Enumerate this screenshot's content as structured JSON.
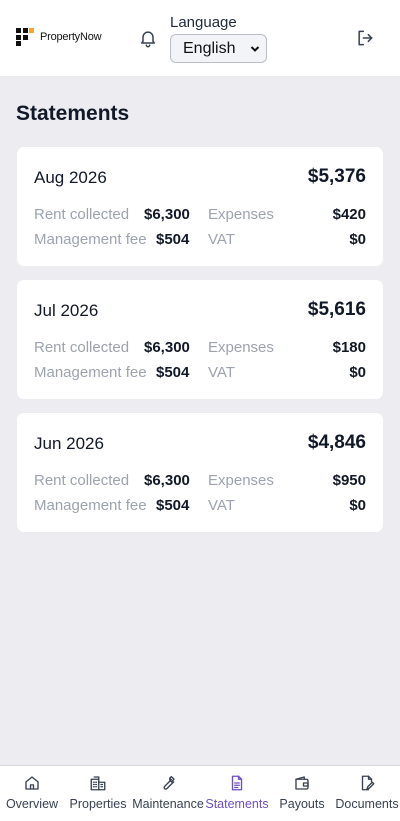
{
  "header": {
    "brand": "PropertyNow",
    "language_label": "Language",
    "language_value": "English"
  },
  "page": {
    "title": "Statements"
  },
  "statements": [
    {
      "month": "Aug 2026",
      "total": "$5,376",
      "rent_label": "Rent collected",
      "rent": "$6,300",
      "expenses_label": "Expenses",
      "expenses": "$420",
      "fee_label": "Management fee",
      "fee": "$504",
      "vat_label": "VAT",
      "vat": "$0"
    },
    {
      "month": "Jul 2026",
      "total": "$5,616",
      "rent_label": "Rent collected",
      "rent": "$6,300",
      "expenses_label": "Expenses",
      "expenses": "$180",
      "fee_label": "Management fee",
      "fee": "$504",
      "vat_label": "VAT",
      "vat": "$0"
    },
    {
      "month": "Jun 2026",
      "total": "$4,846",
      "rent_label": "Rent collected",
      "rent": "$6,300",
      "expenses_label": "Expenses",
      "expenses": "$950",
      "fee_label": "Management fee",
      "fee": "$504",
      "vat_label": "VAT",
      "vat": "$0"
    }
  ],
  "nav": {
    "active": "Statements",
    "active_color": "#6d4fc2",
    "items": [
      {
        "label": "Overview",
        "icon": "home-icon"
      },
      {
        "label": "Properties",
        "icon": "building-icon"
      },
      {
        "label": "Maintenance",
        "icon": "wrench-icon"
      },
      {
        "label": "Statements",
        "icon": "document-icon"
      },
      {
        "label": "Payouts",
        "icon": "wallet-icon"
      },
      {
        "label": "Documents",
        "icon": "file-edit-icon"
      }
    ]
  }
}
